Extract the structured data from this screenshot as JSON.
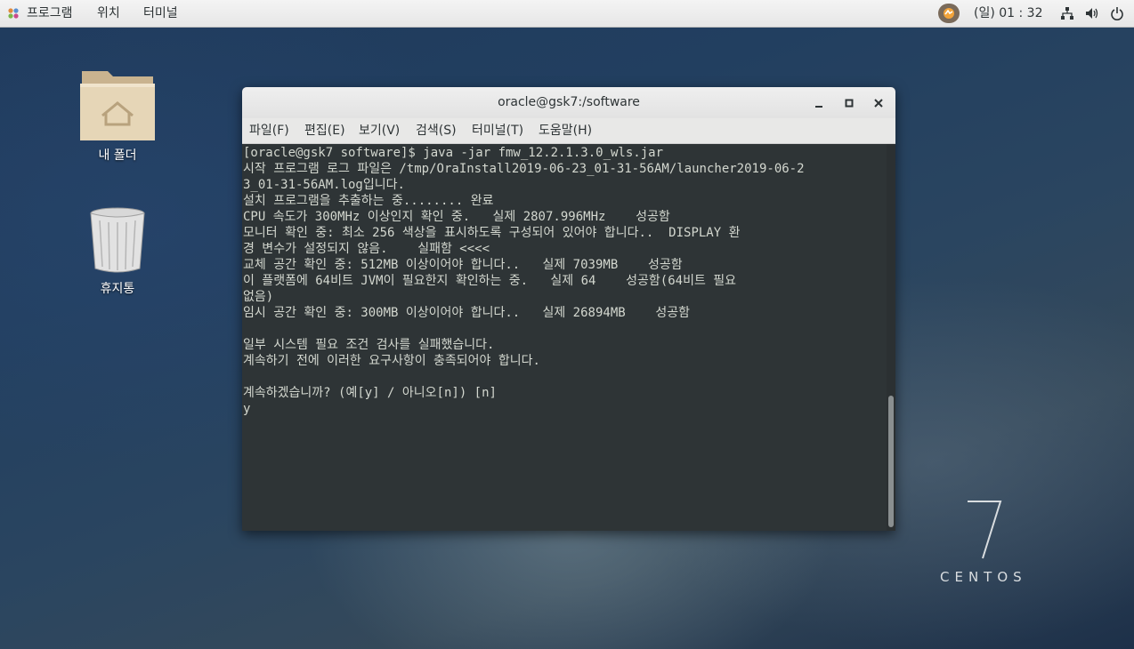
{
  "topbar": {
    "menus": [
      "프로그램",
      "위치",
      "터미널"
    ],
    "clock": "(일) 01 : 32"
  },
  "desktop": {
    "icons": [
      {
        "label": "내 폴더",
        "icon": "home-folder-icon"
      },
      {
        "label": "휴지통",
        "icon": "trash-icon"
      }
    ],
    "watermark": {
      "number": "7",
      "text": "CENTOS"
    }
  },
  "terminal": {
    "title": "oracle@gsk7:/software",
    "menu": [
      "파일(F)",
      "편집(E)",
      "보기(V)",
      "검색(S)",
      "터미널(T)",
      "도움말(H)"
    ],
    "lines": [
      "[oracle@gsk7 software]$ java -jar fmw_12.2.1.3.0_wls.jar",
      "시작 프로그램 로그 파일은 /tmp/OraInstall2019-06-23_01-31-56AM/launcher2019-06-2",
      "3_01-31-56AM.log입니다.",
      "설치 프로그램을 추출하는 중........ 완료",
      "CPU 속도가 300MHz 이상인지 확인 중.   실제 2807.996MHz    성공함",
      "모니터 확인 중: 최소 256 색상을 표시하도록 구성되어 있어야 합니다..  DISPLAY 환",
      "경 변수가 설정되지 않음.    실패함 <<<<",
      "교체 공간 확인 중: 512MB 이상이어야 합니다..   실제 7039MB    성공함",
      "이 플랫폼에 64비트 JVM이 필요한지 확인하는 중.   실제 64    성공함(64비트 필요",
      "없음)",
      "임시 공간 확인 중: 300MB 이상이어야 합니다..   실제 26894MB    성공함",
      "",
      "일부 시스템 필요 조건 검사를 실패했습니다.",
      "계속하기 전에 이러한 요구사항이 충족되어야 합니다.",
      "",
      "계속하겠습니까? (예[y] / 아니오[n]) [n]",
      "y"
    ]
  },
  "colors": {
    "terminal_bg": "#2e3436",
    "terminal_fg": "#d3d7cf",
    "topbar_bg": "#ececec"
  }
}
